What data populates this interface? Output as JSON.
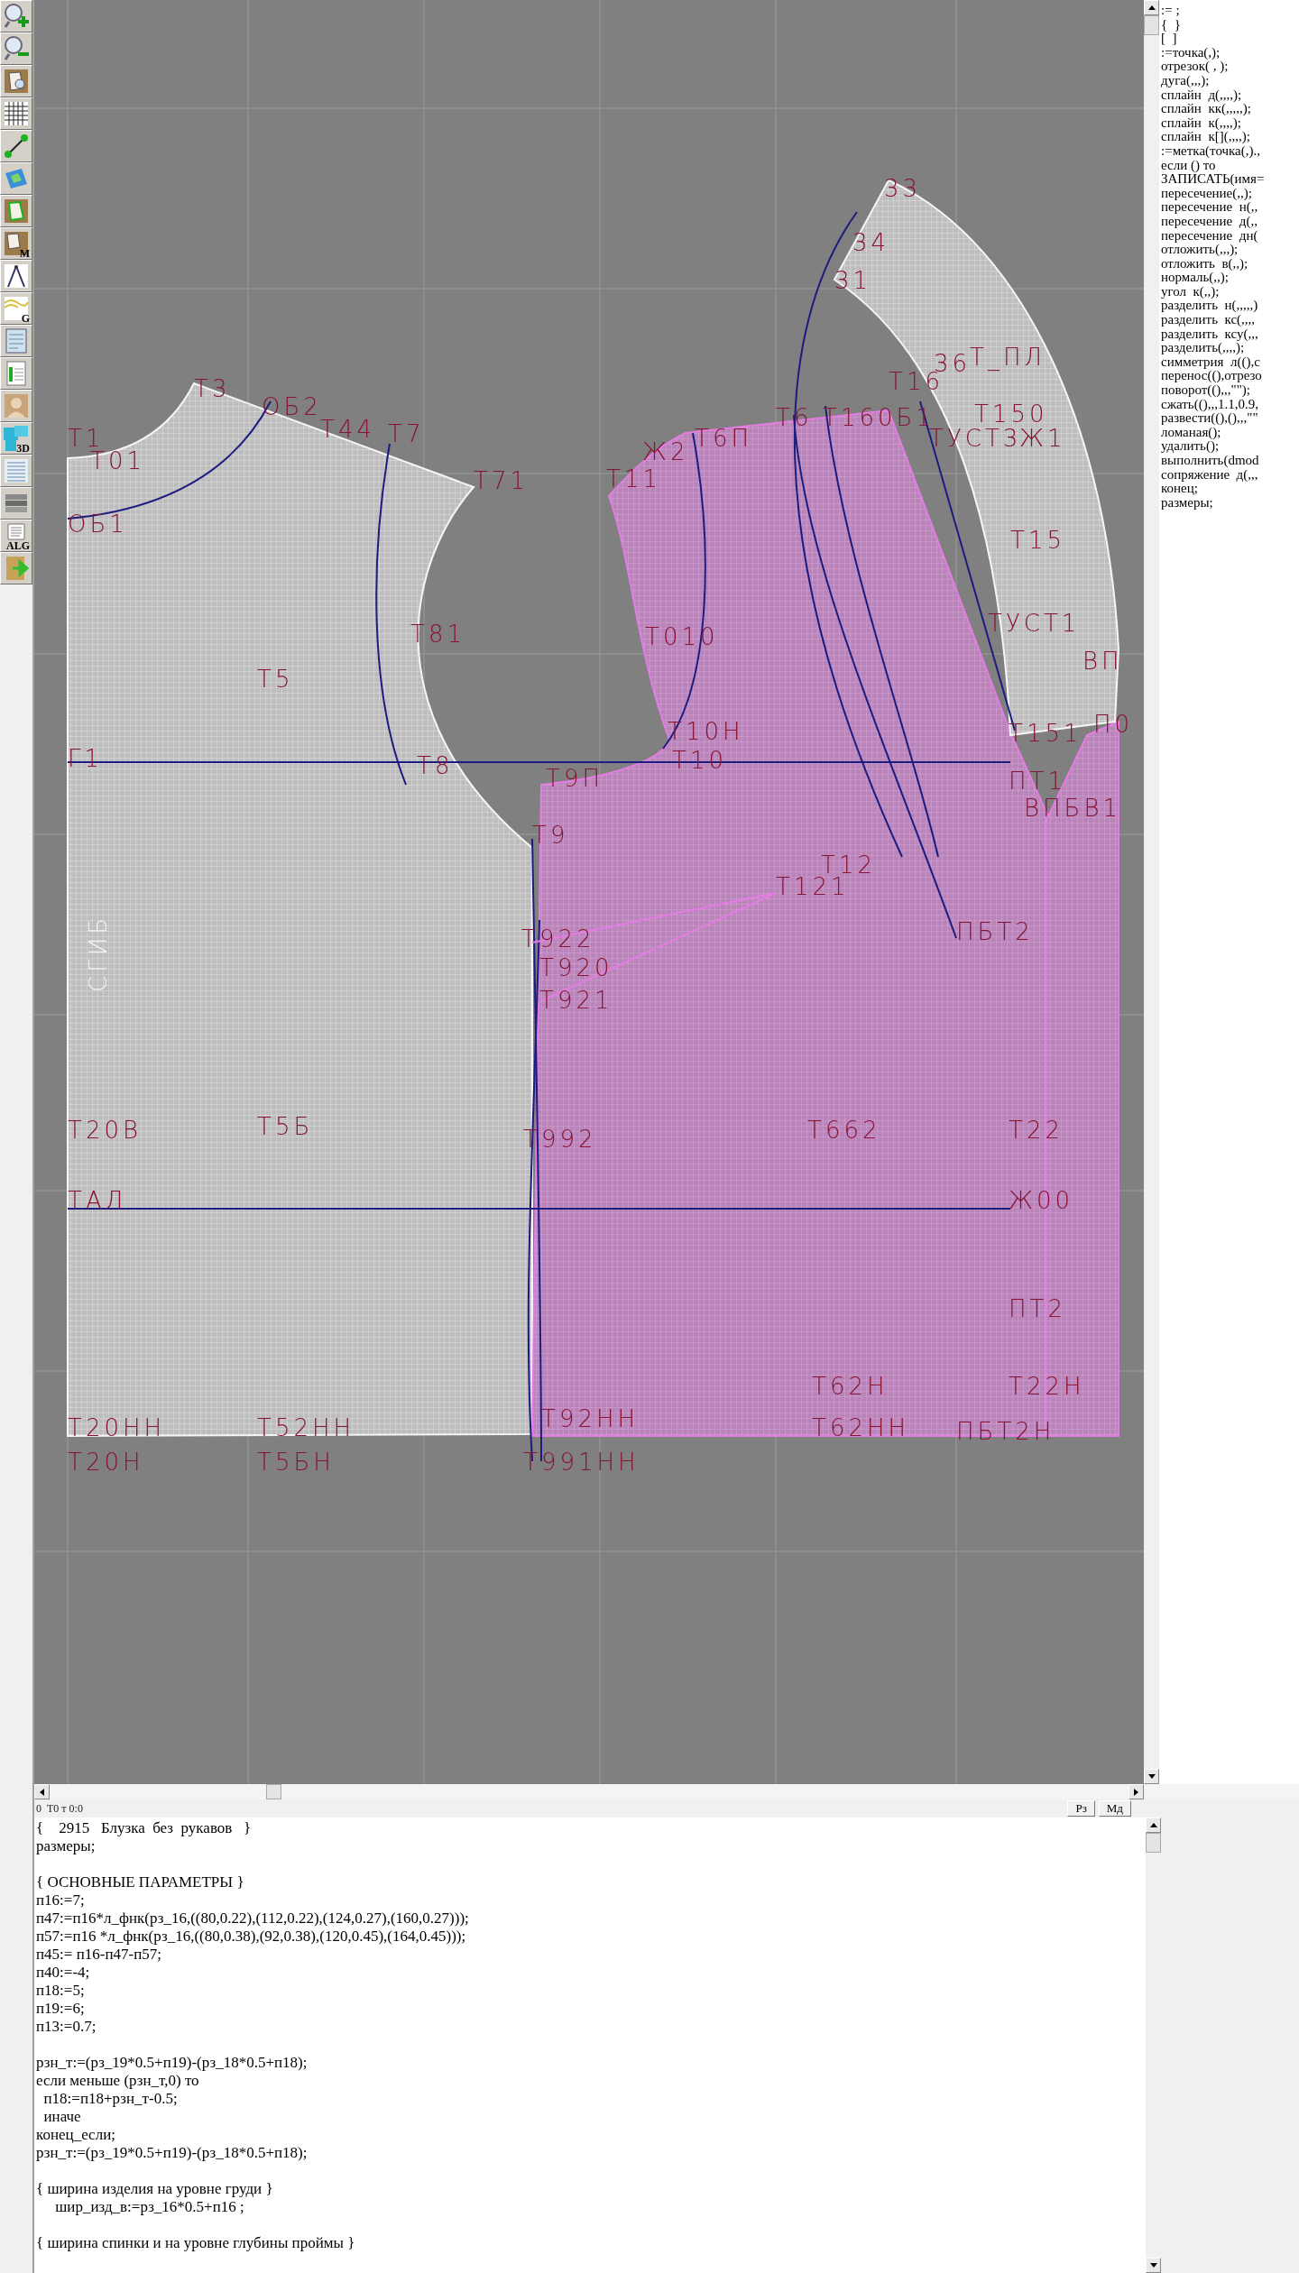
{
  "toolbar": [
    {
      "kind": "zoom-in"
    },
    {
      "kind": "zoom-out"
    },
    {
      "kind": "piece"
    },
    {
      "kind": "grid"
    },
    {
      "kind": "segment"
    },
    {
      "kind": "map"
    },
    {
      "kind": "piece-outline"
    },
    {
      "kind": "piece-letter",
      "label": "M"
    },
    {
      "kind": "compass"
    },
    {
      "kind": "graph",
      "label": "G"
    },
    {
      "kind": "document"
    },
    {
      "kind": "table"
    },
    {
      "kind": "portrait"
    },
    {
      "kind": "model",
      "label": "3D"
    },
    {
      "kind": "list"
    },
    {
      "kind": "books"
    },
    {
      "kind": "algorithm",
      "label": "ALG"
    },
    {
      "kind": "exit"
    }
  ],
  "canvas": {
    "fold_label": "СГИБ",
    "point_labels": [
      "Т3",
      "ОБ2",
      "Т44",
      "Т7",
      "Т71",
      "Т1",
      "Т01",
      "ОБ1",
      "Т81",
      "Т5",
      "Г1",
      "Т8",
      "Т9П",
      "Т9",
      "Т11",
      "Ж2",
      "Т6П",
      "Т010",
      "Т10Н",
      "Т10",
      "Т_ПЛ",
      "36",
      "Т16",
      "Т6",
      "Т160Б1",
      "Т150",
      "ТУСТ3",
      "Ж1",
      "33",
      "34",
      "31",
      "Т15",
      "ТУСТ1",
      "ВП",
      "Т151",
      "П0",
      "ПТ1",
      "ВПБВ1",
      "Т121",
      "Т12",
      "ПБТ2",
      "Т922",
      "Т920",
      "Т921",
      "Т20В",
      "Т5Б",
      "Т992",
      "Т662",
      "Т22",
      "ТАЛ",
      "Ж00",
      "ПТ2",
      "Т62Н",
      "Т22Н",
      "Т20НН",
      "Т52НН",
      "Т92НН",
      "Т62НН",
      "ПБТ2Н",
      "Т20Н",
      "Т5БН",
      "Т991НН"
    ]
  },
  "status_bar": {
    "text": "0  Т0 т 0:0",
    "buttons": [
      "Рз",
      "Мд"
    ]
  },
  "snippets": [
    ":= ;",
    "{  }",
    "[  ]",
    ":=точка(,);",
    "отрезок( , );",
    "дуга(,,,);",
    "сплайн  д(,,,,);",
    "сплайн  кк(,,,,,);",
    "сплайн  к(,,,,);",
    "сплайн  к[](,,,,);",
    ":=метка(точка(,).,",
    "если () то",
    "ЗАПИСАТЬ(имя=",
    "пересечение(,,);",
    "пересечение  н(,,",
    "пересечение  д(,,",
    "пересечение  дн(",
    "отложить(,,,);",
    "отложить  в(,,);",
    "нормаль(,,);",
    "угол  к(,,);",
    "разделить  н(,,,,,)",
    "разделить  кс(,,,,",
    "разделить  ксу(,,,",
    "разделить(,,,,);",
    "симметрия  л((),с",
    "перенос((),отрезо",
    "поворот((),,,\"\");",
    "сжать((),,,1.1,0.9,",
    "развести((),(),,,\"\"",
    "ломаная();",
    "удалить();",
    "выполнить(dmod",
    "сопряжение  д(,,,",
    "конец;",
    "размеры;"
  ],
  "code_blocks": [
    [
      "{    2915   Блузка  без  рукавов   }",
      "размеры;"
    ],
    [
      "{ ОСНОВНЫЕ ПАРАМЕТРЫ }",
      "п16:=7;",
      "п47:=п16*л_фнк(рз_16,((80,0.22),(112,0.22),(124,0.27),(160,0.27)));",
      "п57:=п16 *л_фнк(рз_16,((80,0.38),(92,0.38),(120,0.45),(164,0.45)));",
      "п45:= п16-п47-п57;",
      "п40:=-4;",
      "п18:=5;",
      "п19:=6;",
      "п13:=0.7;"
    ],
    [
      "рзн_т:=(рз_19*0.5+п19)-(рз_18*0.5+п18);",
      "если меньше (рзн_т,0) то",
      "  п18:=п18+рзн_т-0.5;",
      "  иначе",
      "конец_если;",
      "рзн_т:=(рз_19*0.5+п19)-(рз_18*0.5+п18);"
    ],
    [
      "{ ширина изделия на уровне груди }",
      "     шир_изд_в:=рз_16*0.5+п16 ;"
    ],
    [
      "{ ширина спинки и на уровне глубины проймы }"
    ]
  ]
}
